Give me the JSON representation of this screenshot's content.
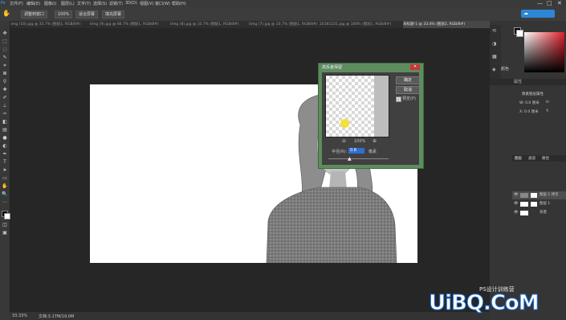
{
  "menubar": {
    "items": [
      "文件(F)",
      "编辑(E)",
      "图像(I)",
      "图层(L)",
      "文字(Y)",
      "选择(S)",
      "滤镜(T)",
      "3D(D)",
      "视图(V)",
      "窗口(W)",
      "帮助(H)"
    ],
    "minimize": "—",
    "maximize": "□",
    "close": "✕"
  },
  "optionsbar": {
    "button1": "调整到窗口",
    "zoom": "100%",
    "button2": "适合屏幕",
    "button3": "填充屏幕"
  },
  "tabs": [
    "timg (10).jpg @ 33.7% (图层1, RGB/8#)",
    "timg (9).jpg @ 66.7% (图层1, RGB/8#)",
    "timg (8).jpg @ 33.7% (图层1, RGB/8#)",
    "timg (7).jpg @ 33.7% (图层1, RGB/8#)",
    "20181231.jpg @ 100% (图层1, RGB/8#)",
    "未标题-1 @ 33.4% (图层2, RGB/8#)"
  ],
  "status": {
    "zoom": "33.33%",
    "doc": "文档:3.17M/19.0M"
  },
  "dialog": {
    "title": "高反差保留",
    "ok": "确定",
    "cancel": "取消",
    "preview": "预览(P)",
    "zoom_pct": "100%",
    "radius_label": "半径(R):",
    "radius_value": "0.8",
    "radius_unit": "像素"
  },
  "color_panel": {
    "title": "颜色"
  },
  "properties": {
    "title": "属性",
    "subtitle": "像素图层属性",
    "w": "W: 0.0 厘米",
    "x": "X: 0.0 厘米",
    "h": "H:",
    "y": "Y:"
  },
  "layers": {
    "tabs": [
      "图层",
      "通道",
      "路径"
    ],
    "rows": [
      "图层 1 拷贝",
      "图层 1",
      "背景"
    ]
  },
  "watermark": {
    "brand": "PS设计训练营",
    "site": "UiBQ.CoM"
  }
}
